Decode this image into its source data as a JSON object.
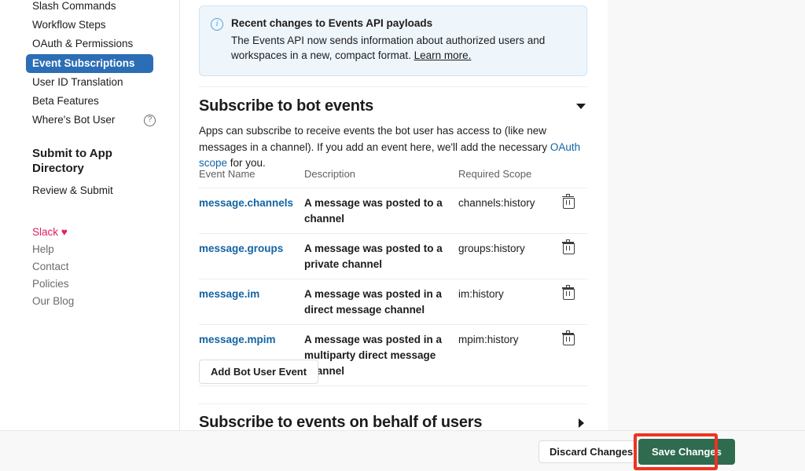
{
  "sidebar": {
    "items": [
      {
        "label": "Slash Commands",
        "active": false,
        "help": false
      },
      {
        "label": "Workflow Steps",
        "active": false,
        "help": false
      },
      {
        "label": "OAuth & Permissions",
        "active": false,
        "help": false
      },
      {
        "label": "Event Subscriptions",
        "active": true,
        "help": false
      },
      {
        "label": "User ID Translation",
        "active": false,
        "help": false
      },
      {
        "label": "Beta Features",
        "active": false,
        "help": false
      },
      {
        "label": "Where's Bot User",
        "active": false,
        "help": true
      }
    ],
    "help_glyph": "?",
    "heading": "Submit to App Directory",
    "secondary_items": [
      {
        "label": "Review & Submit"
      }
    ],
    "footer_links": [
      {
        "label": "Slack ♥",
        "brand": true
      },
      {
        "label": "Help",
        "brand": false
      },
      {
        "label": "Contact",
        "brand": false
      },
      {
        "label": "Policies",
        "brand": false
      },
      {
        "label": "Our Blog",
        "brand": false
      }
    ],
    "active_color": "#2c6eb5",
    "brand_color": "#e01e5a"
  },
  "banner": {
    "icon": "info-icon",
    "icon_glyph": "i",
    "title": "Recent changes to Events API payloads",
    "body_before_link": "The Events API now sends information about authorized users and workspaces in a new, compact format. ",
    "link_text": "Learn more.",
    "background": "#eef6fc",
    "border": "#cfe3f3"
  },
  "bot_events_section": {
    "title": "Subscribe to bot events",
    "expanded": true,
    "caret": "chevron-down-icon",
    "description_part1": "Apps can subscribe to receive events the bot user has access to (like new messages in a channel). If you add an event here, we'll add the necessary ",
    "description_link": "OAuth scope",
    "description_part2": " for you.",
    "link_color": "#1264a3",
    "table": {
      "headers": [
        "Event Name",
        "Description",
        "Required Scope",
        ""
      ],
      "rows": [
        {
          "name": "message.channels",
          "description": "A message was posted to a channel",
          "scope": "channels:history",
          "action": "delete-icon"
        },
        {
          "name": "message.groups",
          "description": "A message was posted to a private channel",
          "scope": "groups:history",
          "action": "delete-icon"
        },
        {
          "name": "message.im",
          "description": "A message was posted in a direct message channel",
          "scope": "im:history",
          "action": "delete-icon"
        },
        {
          "name": "message.mpim",
          "description": "A message was posted in a multiparty direct message channel",
          "scope": "mpim:history",
          "action": "delete-icon"
        }
      ]
    },
    "add_button": "Add Bot User Event"
  },
  "user_events_section": {
    "title": "Subscribe to events on behalf of users",
    "expanded": false,
    "caret": "chevron-right-icon"
  },
  "action_bar": {
    "discard_label": "Discard Changes",
    "save_label": "Save Changes",
    "save_color": "#2f6b4f",
    "highlight_color": "#ee3322"
  }
}
